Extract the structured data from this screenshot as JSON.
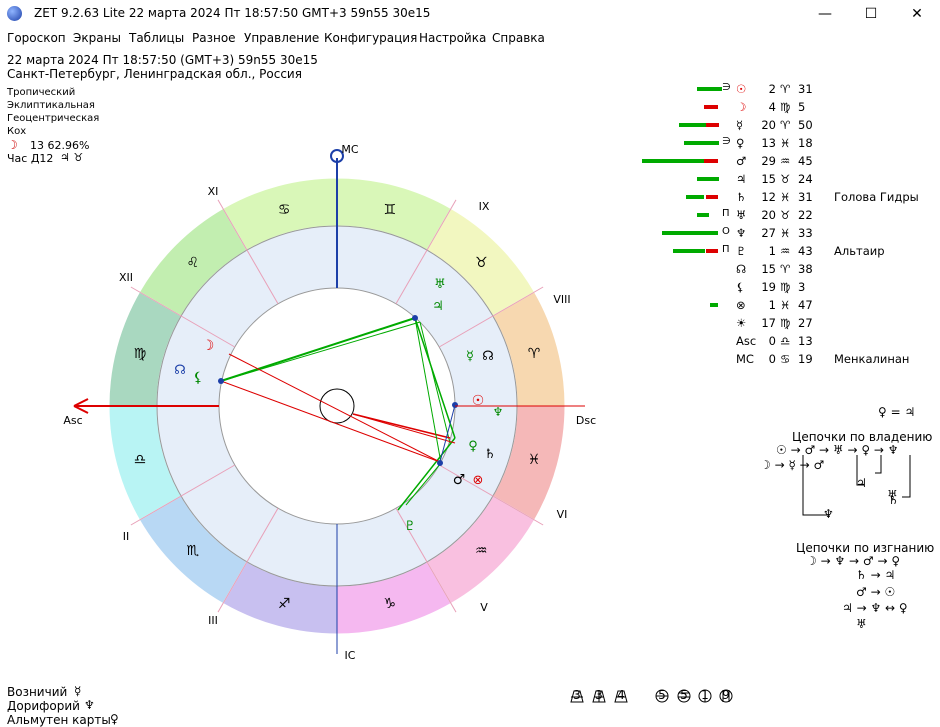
{
  "window": {
    "title": "ZET 9.2.63 Lite   22 марта 2024  Пт  18:57:50 GMT+3 59n55  30e15",
    "minimize": "—",
    "maximize": "☐",
    "close": "✕"
  },
  "menu": [
    "Гороскоп",
    "Экраны",
    "Таблицы",
    "Разное",
    "Управление",
    "Конфигурация",
    "Настройка",
    "Справка"
  ],
  "info": {
    "line1": "22 марта 2024   Пт   18:57:50  (GMT+3)  59n55   30e15",
    "line2": "Санкт-Петербург, Ленинградская обл., Россия",
    "zodiac": "Тропический",
    "coords": "Эклиптикальная",
    "center": "Геоцентрическая",
    "houses": "Кох",
    "moon_phase_symbol": "☽",
    "moon_phase": "13  62.96%",
    "hour_label": "Час Д12",
    "hour_symbols": "♃ ♉"
  },
  "chart": {
    "angle_labels": {
      "mc": "MC",
      "ic": "IC",
      "asc": "Asc",
      "dsc": "Dsc"
    },
    "house_labels": [
      "XI",
      "IX",
      "XII",
      "VIII",
      "II",
      "VI",
      "III",
      "V"
    ],
    "sign_glyphs": [
      "♋",
      "♊",
      "♌",
      "♉",
      "♍",
      "♈",
      "♎",
      "♓",
      "♏",
      "♒",
      "♐",
      "♑"
    ],
    "sign_colors": [
      "#d9f7b8",
      "#f2f7c0",
      "#c2eeb0",
      "#f7d8b0",
      "#a9d8c0",
      "#f5b8b8",
      "#b8f4f4",
      "#f9c0e0",
      "#b8d8f4",
      "#f5b8f0",
      "#c8c0f0",
      "#e0c0f4"
    ],
    "planet_glyphs": [
      "☉",
      "☽",
      "☿",
      "♀",
      "♂",
      "♃",
      "♄",
      "♅",
      "♆",
      "♇",
      "☊",
      "⊗",
      "☀",
      "⚷"
    ]
  },
  "planets": [
    {
      "pre": "∋",
      "glyph": "☉",
      "deg": "2",
      "sign": "♈",
      "min": "31",
      "note": ""
    },
    {
      "pre": "",
      "glyph": "☽",
      "deg": "4",
      "sign": "♍",
      "min": "5",
      "note": ""
    },
    {
      "pre": "",
      "glyph": "☿",
      "deg": "20",
      "sign": "♈",
      "min": "50",
      "note": ""
    },
    {
      "pre": "∋",
      "glyph": "♀",
      "deg": "13",
      "sign": "♓",
      "min": "18",
      "note": ""
    },
    {
      "pre": "",
      "glyph": "♂",
      "deg": "29",
      "sign": "♒",
      "min": "45",
      "note": ""
    },
    {
      "pre": "",
      "glyph": "♃",
      "deg": "15",
      "sign": "♉",
      "min": "24",
      "note": ""
    },
    {
      "pre": "",
      "glyph": "♄",
      "deg": "12",
      "sign": "♓",
      "min": "31",
      "note": "Голова Гидры"
    },
    {
      "pre": "П",
      "glyph": "♅",
      "deg": "20",
      "sign": "♉",
      "min": "22",
      "note": ""
    },
    {
      "pre": "О",
      "glyph": "♆",
      "deg": "27",
      "sign": "♓",
      "min": "33",
      "note": ""
    },
    {
      "pre": "П",
      "glyph": "♇",
      "deg": "1",
      "sign": "♒",
      "min": "43",
      "note": "Альтаир"
    },
    {
      "pre": "",
      "glyph": "☊",
      "deg": "15",
      "sign": "♈",
      "min": "38",
      "note": ""
    },
    {
      "pre": "",
      "glyph": "⚸",
      "deg": "19",
      "sign": "♍",
      "min": "3",
      "note": ""
    },
    {
      "pre": "",
      "glyph": "⊗",
      "deg": "1",
      "sign": "♓",
      "min": "47",
      "note": ""
    },
    {
      "pre": "",
      "glyph": "☀",
      "deg": "17",
      "sign": "♍",
      "min": "27",
      "note": ""
    },
    {
      "pre": "",
      "glyph": "Asc",
      "deg": "0",
      "sign": "♎",
      "min": "13",
      "note": ""
    },
    {
      "pre": "",
      "glyph": "MC",
      "deg": "0",
      "sign": "♋",
      "min": "19",
      "note": "Менкалинан"
    }
  ],
  "chains": {
    "venus_jupiter": "♀ = ♃",
    "rule_title": "Цепочки по владению",
    "rule_line1": "☉ → ♂ → ♅ → ♀ → ♆",
    "rule_line2": "☽ → ☿ → ♂",
    "rule_line3": "♃",
    "rule_line4": "♅",
    "rule_line5": "♄",
    "rule_line6": "♆",
    "exile_title": "Цепочки по изгнанию",
    "exile_line1": "☽ → ♆ → ♂ → ♀",
    "exile_line2": "♄ → ♃",
    "exile_line3": "♂ → ☉",
    "exile_line4": "♃ → ♆ ↔ ♀",
    "exile_line5": "♅"
  },
  "bottom": {
    "label1": "Возничий",
    "sym1": "☿",
    "label2": "Дорифорий",
    "sym2": "♆",
    "label3": "Альмутен карты",
    "sym3": "♀"
  },
  "stats": [
    "3",
    "3",
    "4",
    "5",
    "5",
    "1",
    "9"
  ]
}
